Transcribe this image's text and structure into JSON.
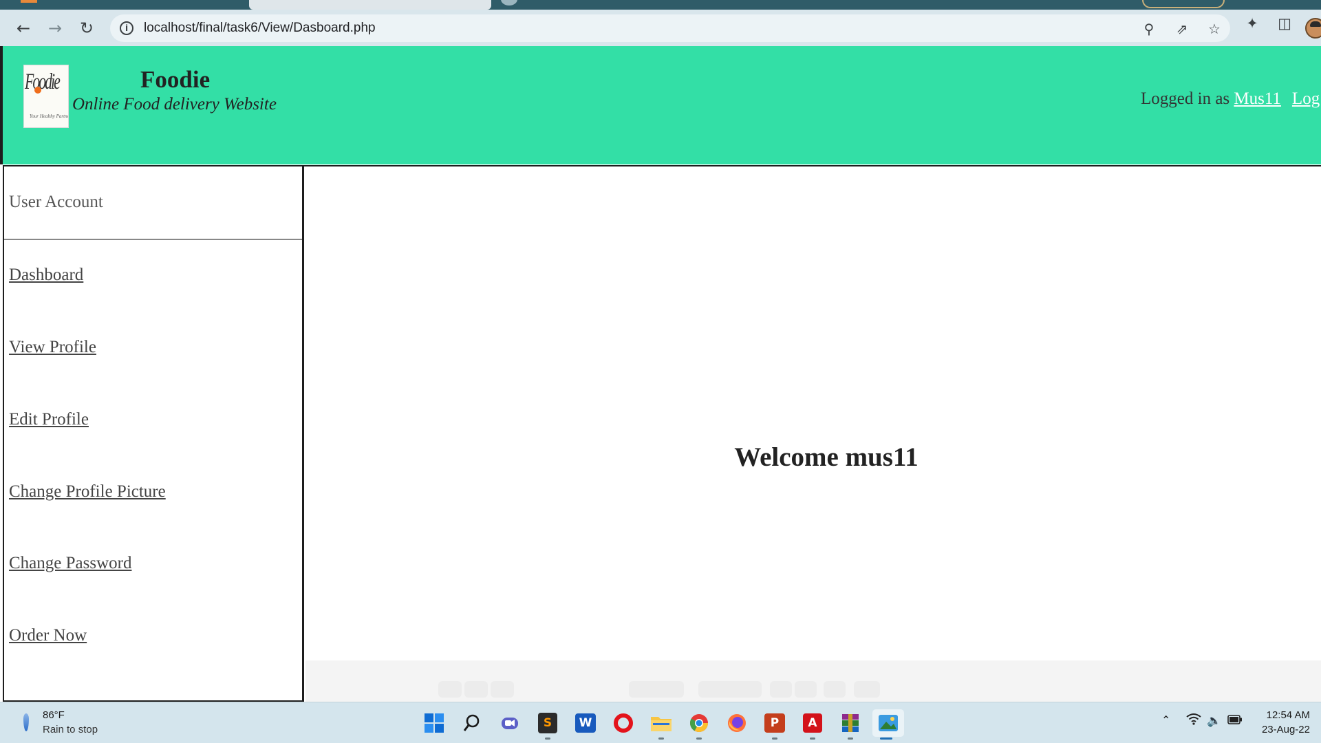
{
  "browser": {
    "url": "localhost/final/task6/View/Dasboard.php",
    "icons": {
      "back": "arrow-left",
      "forward": "arrow-right",
      "reload": "reload",
      "site_info": "info",
      "zoom": "magnifier",
      "share": "share",
      "bookmark": "star",
      "extensions": "puzzle",
      "side_panel": "panel"
    }
  },
  "site": {
    "title": "Foodie",
    "subtitle": "Online Food delivery Website",
    "logo_text": "Foodie",
    "logo_tagline": "Your Healthy Partner",
    "login": {
      "prefix": "Logged in as",
      "username": "Mus11",
      "logout": "Log"
    },
    "colors": {
      "header_bg": "#33dfa6",
      "link_text": "#444444"
    }
  },
  "sidebar": {
    "heading": "User Account",
    "items": [
      {
        "label": "Dashboard"
      },
      {
        "label": "View Profile"
      },
      {
        "label": "Edit Profile"
      },
      {
        "label": "Change Profile Picture"
      },
      {
        "label": "Change Password"
      },
      {
        "label": "Order Now"
      }
    ]
  },
  "main": {
    "welcome": "Welcome mus11"
  },
  "taskbar": {
    "weather": {
      "temp": "86°F",
      "desc": "Rain to stop"
    },
    "apps": [
      {
        "name": "start",
        "icon": "windows-logo"
      },
      {
        "name": "search",
        "icon": "search"
      },
      {
        "name": "chat",
        "icon": "camera"
      },
      {
        "name": "sublime-text",
        "icon": "S"
      },
      {
        "name": "word",
        "icon": "W"
      },
      {
        "name": "opera",
        "icon": "O"
      },
      {
        "name": "file-explorer",
        "icon": "folder"
      },
      {
        "name": "chrome",
        "icon": "chrome"
      },
      {
        "name": "firefox",
        "icon": "firefox"
      },
      {
        "name": "powerpoint",
        "icon": "P"
      },
      {
        "name": "acrobat",
        "icon": "A"
      },
      {
        "name": "winrar",
        "icon": "archive"
      },
      {
        "name": "photos",
        "icon": "image"
      }
    ],
    "tray": {
      "wifi": "wifi",
      "volume": "speaker",
      "battery": "battery"
    },
    "clock": {
      "time": "12:54 AM",
      "date": "23-Aug-22"
    }
  }
}
